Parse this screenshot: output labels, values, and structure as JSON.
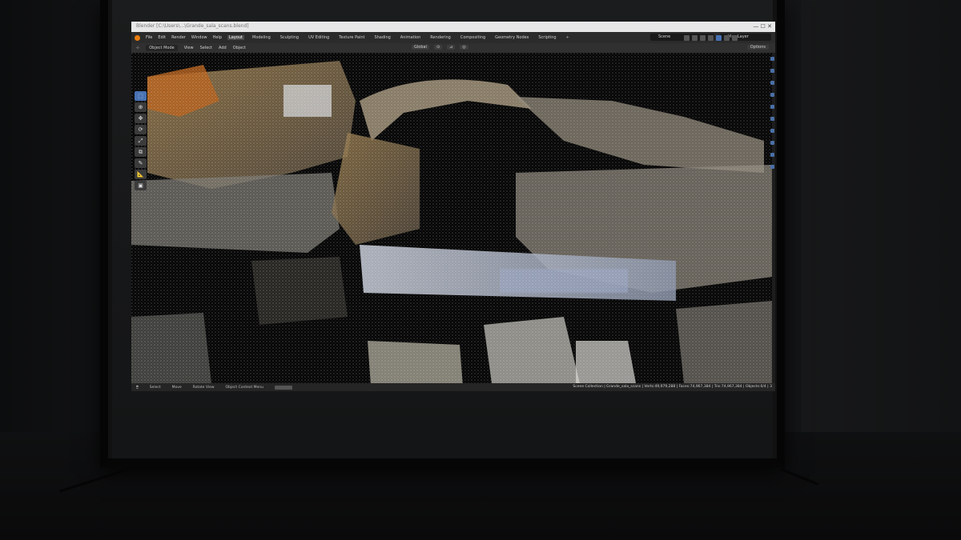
{
  "window": {
    "title": "Blender [C:\\Users\\...\\Grande_sala_scans.blend]"
  },
  "menus": [
    "File",
    "Edit",
    "Render",
    "Window",
    "Help"
  ],
  "workspaces": [
    {
      "label": "Layout",
      "active": true
    },
    {
      "label": "Modeling"
    },
    {
      "label": "Sculpting"
    },
    {
      "label": "UV Editing"
    },
    {
      "label": "Texture Paint"
    },
    {
      "label": "Shading"
    },
    {
      "label": "Animation"
    },
    {
      "label": "Rendering"
    },
    {
      "label": "Compositing"
    },
    {
      "label": "Geometry Nodes"
    },
    {
      "label": "Scripting"
    }
  ],
  "add_workspace": "+",
  "scene": {
    "label": "Scene"
  },
  "view_layer": {
    "label": "ViewLayer"
  },
  "header": {
    "mode": "Object Mode",
    "items": [
      "View",
      "Select",
      "Add",
      "Object"
    ],
    "transform_orientation": "Global",
    "options": "Options"
  },
  "toolbar": {
    "tools": [
      {
        "name": "select-box-tool",
        "glyph": "⬚",
        "active": true
      },
      {
        "name": "cursor-tool",
        "glyph": "⊕"
      },
      {
        "name": "move-tool",
        "glyph": "✥"
      },
      {
        "name": "rotate-tool",
        "glyph": "⟳"
      },
      {
        "name": "scale-tool",
        "glyph": "⤢"
      },
      {
        "name": "transform-tool",
        "glyph": "⧉"
      },
      {
        "name": "annotate-tool",
        "glyph": "✎"
      },
      {
        "name": "measure-tool",
        "glyph": "📐"
      },
      {
        "name": "add-cube-tool",
        "glyph": "▣"
      }
    ]
  },
  "status": {
    "select": "Select",
    "move": "Move",
    "rotate_view": "Rotate View",
    "context_menu": "Object Context Menu",
    "stats": "Scene Collection | Grande_sala_scans | Verts:49,979,288 | Faces:74,967,384 | Tris:74,967,384 | Objects:0/4 | 3"
  },
  "colors": {
    "accent": "#4772b3",
    "brand": "#e87d0d"
  }
}
